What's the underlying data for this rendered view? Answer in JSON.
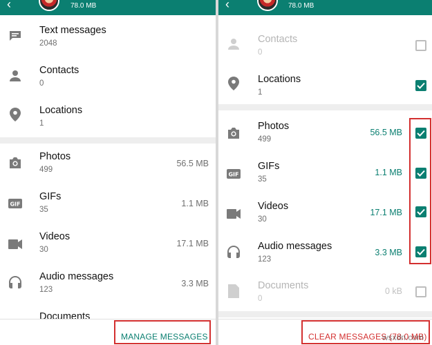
{
  "left": {
    "header": {
      "back_icon": "back-arrow-icon",
      "size": "78.0 MB"
    },
    "items": [
      {
        "title": "Text messages",
        "count": "2048",
        "icon": "message-icon"
      },
      {
        "title": "Contacts",
        "count": "0",
        "icon": "person-icon"
      },
      {
        "title": "Locations",
        "count": "1",
        "icon": "location-pin-icon"
      },
      {
        "title": "Photos",
        "count": "499",
        "size": "56.5 MB",
        "icon": "camera-icon"
      },
      {
        "title": "GIFs",
        "count": "35",
        "size": "1.1 MB",
        "icon": "gif-icon"
      },
      {
        "title": "Videos",
        "count": "30",
        "size": "17.1 MB",
        "icon": "video-icon"
      },
      {
        "title": "Audio messages",
        "count": "123",
        "size": "3.3 MB",
        "icon": "headphones-icon"
      },
      {
        "title": "Documents",
        "icon": "document-icon"
      }
    ],
    "footer_button": "MANAGE MESSAGES"
  },
  "right": {
    "header": {
      "back_icon": "back-arrow-icon",
      "size": "78.0 MB"
    },
    "items": [
      {
        "title": "Contacts",
        "count": "0",
        "icon": "person-icon",
        "checked": false
      },
      {
        "title": "Locations",
        "count": "1",
        "icon": "location-pin-icon",
        "checked": true
      },
      {
        "title": "Photos",
        "count": "499",
        "size": "56.5 MB",
        "icon": "camera-icon",
        "checked": true
      },
      {
        "title": "GIFs",
        "count": "35",
        "size": "1.1 MB",
        "icon": "gif-icon",
        "checked": true
      },
      {
        "title": "Videos",
        "count": "30",
        "size": "17.1 MB",
        "icon": "video-icon",
        "checked": true
      },
      {
        "title": "Audio messages",
        "count": "123",
        "size": "3.3 MB",
        "icon": "headphones-icon",
        "checked": true
      },
      {
        "title": "Documents",
        "count": "0",
        "size": "0 kB",
        "icon": "document-icon",
        "checked": false
      }
    ],
    "footer_button": "CLEAR MESSAGES (78.0 MB)"
  },
  "colors": {
    "accent": "#0b7f71",
    "highlight": "#d32f2f"
  },
  "watermark": "wsxdn.com"
}
